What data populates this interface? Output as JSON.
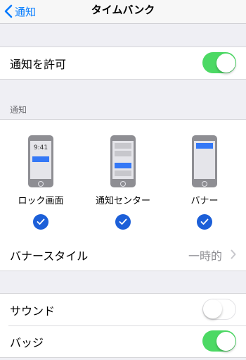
{
  "nav": {
    "back_label": "通知",
    "title": "タイムバンク"
  },
  "allow": {
    "label": "通知を許可",
    "on": true
  },
  "section_header": "通知",
  "alert_styles": [
    {
      "label": "ロック画面",
      "checked": true,
      "time": "9:41"
    },
    {
      "label": "通知センター",
      "checked": true
    },
    {
      "label": "バナー",
      "checked": true
    }
  ],
  "banner_style": {
    "label": "バナースタイル",
    "value": "一時的"
  },
  "sound": {
    "label": "サウンド",
    "on": false
  },
  "badge": {
    "label": "バッジ",
    "on": true
  },
  "colors": {
    "accent": "#007aff",
    "switch_on": "#4cd964",
    "check": "#1c5fd8"
  }
}
